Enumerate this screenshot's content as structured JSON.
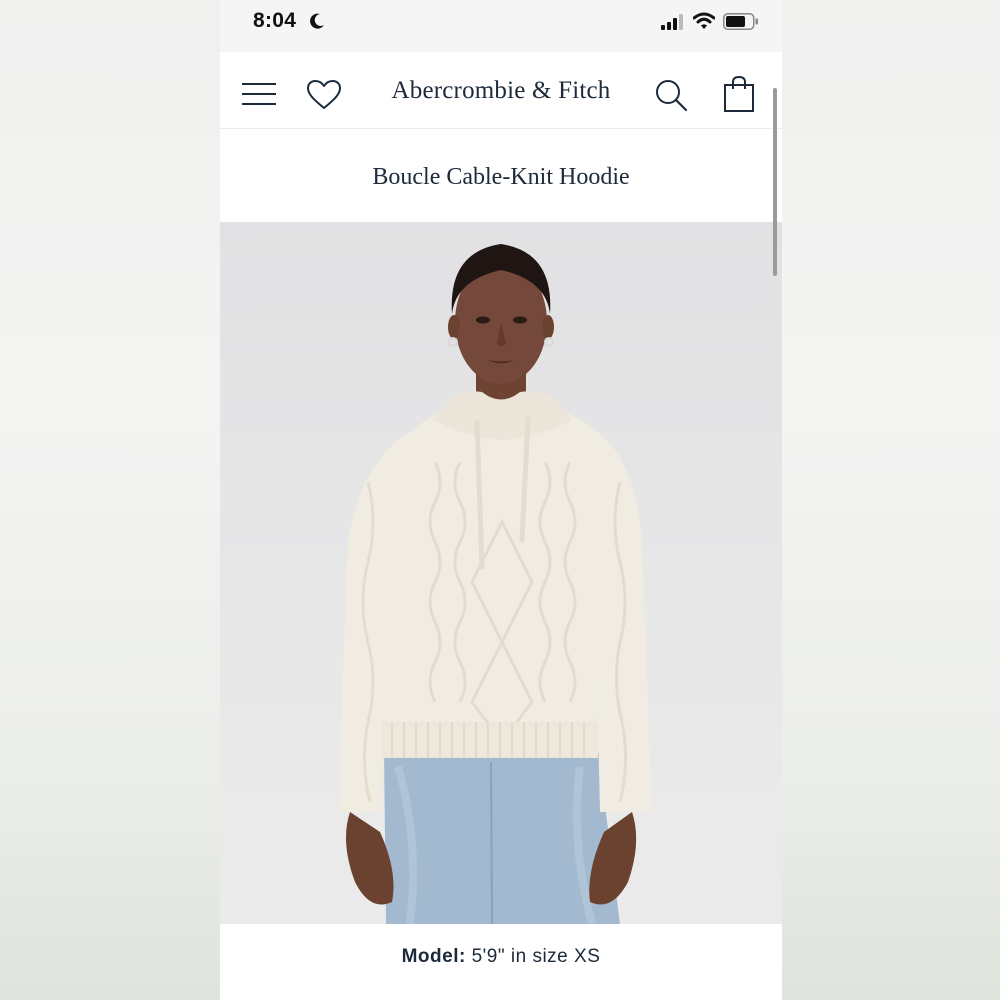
{
  "status_bar": {
    "time": "8:04",
    "icons": [
      "moon-icon",
      "signal-icon",
      "wifi-icon",
      "battery-icon"
    ]
  },
  "header": {
    "icons": [
      "menu-icon",
      "heart-icon",
      "search-icon",
      "bag-icon"
    ],
    "brand": "Abercrombie & Fitch"
  },
  "product": {
    "title": "Boucle Cable-Knit Hoodie",
    "image": "model-wearing-cream-cable-knit-hoodie",
    "model_label": "Model:",
    "model_value": "5'9\" in size XS"
  },
  "colors": {
    "brand_text": "#1c2a3a",
    "sweater": "#f1ece2",
    "jeans": "#9fb6cc"
  }
}
